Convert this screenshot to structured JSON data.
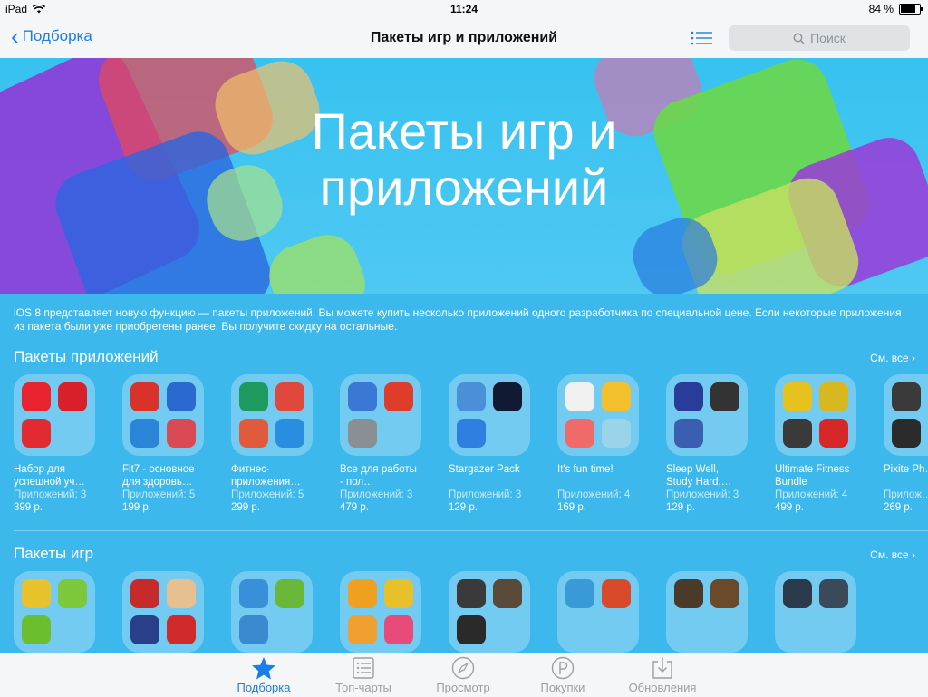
{
  "status": {
    "device": "iPad",
    "time": "11:24",
    "battery": "84 %"
  },
  "nav": {
    "back_label": "Подборка",
    "title": "Пакеты игр и приложений",
    "search_placeholder": "Поиск"
  },
  "banner": {
    "title_line1": "Пакеты игр и",
    "title_line2": "приложений"
  },
  "description": "iOS 8 представляет новую функцию — пакеты приложений. Вы можете купить несколько приложений одного разработчика по специальной цене. Если некоторые приложения из пакета были уже приобретены ранее, Вы получите скидку на остальные.",
  "app_section": {
    "title": "Пакеты приложений",
    "see_all": "См. все",
    "items": [
      {
        "name": "Набор для успешной уч…",
        "info": "Приложений: 3",
        "price": "399 р.",
        "colors": [
          "#e8232d",
          "#d8202a",
          "#e12b30",
          ""
        ]
      },
      {
        "name": "Fit7 - основное для здоровь…",
        "info": "Приложений: 5",
        "price": "199 р.",
        "colors": [
          "#d9322b",
          "#2a6ad0",
          "#2a85d8",
          "#d94a55"
        ]
      },
      {
        "name": "Фитнес-приложения…",
        "info": "Приложений: 5",
        "price": "299 р.",
        "colors": [
          "#1f9a5f",
          "#e0483e",
          "#e25a3c",
          "#2a8ee0"
        ]
      },
      {
        "name": "Все для работы - пол…",
        "info": "Приложений: 3",
        "price": "479 р.",
        "colors": [
          "#3b78d6",
          "#e03c2c",
          "#8a8f94",
          ""
        ]
      },
      {
        "name": "Stargazer Pack",
        "info": "Приложений: 3",
        "price": "129 р.",
        "colors": [
          "#4c8fd9",
          "#111a33",
          "#2f7fe0",
          ""
        ]
      },
      {
        "name": "It's fun time!",
        "info": "Приложений: 4",
        "price": "169 р.",
        "colors": [
          "#f0f0f0",
          "#f2c02a",
          "#f06a6a",
          "#9ad4e8"
        ]
      },
      {
        "name": "Sleep Well, Study Hard,…",
        "info": "Приложений: 3",
        "price": "129 р.",
        "colors": [
          "#2a3c9a",
          "#333333",
          "#3b5fb0",
          ""
        ]
      },
      {
        "name": "Ultimate Fitness Bundle",
        "info": "Приложений: 4",
        "price": "499 р.",
        "colors": [
          "#e6c21f",
          "#d8b820",
          "#3a3a3a",
          "#d62828"
        ]
      },
      {
        "name": "Pixite Ph…",
        "info": "Прилож…",
        "price": "269 р.",
        "colors": [
          "#3a3a3a",
          "#e05c2a",
          "#2b2b2b",
          ""
        ]
      }
    ]
  },
  "game_section": {
    "title": "Пакеты игр",
    "see_all": "См. все",
    "items": [
      {
        "colors": [
          "#e8c22a",
          "#7dc83a",
          "#6bbf2e",
          ""
        ]
      },
      {
        "colors": [
          "#c72a2a",
          "#e8c090",
          "#2a3f8a",
          "#d12a2a"
        ]
      },
      {
        "colors": [
          "#3a90d8",
          "#6ab83a",
          "#3a8ad0",
          ""
        ]
      },
      {
        "colors": [
          "#f0a020",
          "#e8c02a",
          "#f0a030",
          "#e84a7a"
        ]
      },
      {
        "colors": [
          "#3a3a3a",
          "#5a4a3a",
          "#2a2a2a",
          ""
        ]
      },
      {
        "colors": [
          "#3a9ad8",
          "#d84a2a",
          "",
          ""
        ]
      },
      {
        "colors": [
          "#4a3a2a",
          "#6a4a2a",
          "",
          ""
        ]
      },
      {
        "colors": [
          "#2a3a4a",
          "#3a4a5a",
          "",
          ""
        ]
      }
    ]
  },
  "tabs": [
    {
      "label": "Подборка",
      "icon": "star-icon",
      "active": true
    },
    {
      "label": "Топ-чарты",
      "icon": "list-icon",
      "active": false
    },
    {
      "label": "Просмотр",
      "icon": "compass-icon",
      "active": false
    },
    {
      "label": "Покупки",
      "icon": "purchased-icon",
      "active": false
    },
    {
      "label": "Обновления",
      "icon": "download-icon",
      "active": false
    }
  ]
}
